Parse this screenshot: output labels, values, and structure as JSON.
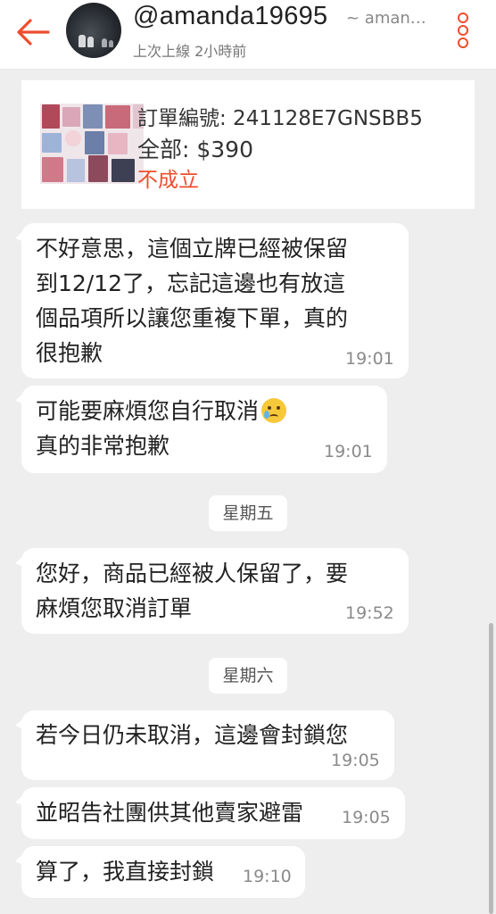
{
  "header": {
    "username": "@amanda19695",
    "shop_name": "~ aman…",
    "last_seen": "上次上線 2小時前"
  },
  "order": {
    "order_number": "訂單編號: 241128E7GNSBB5",
    "total": "全部: $390",
    "status": "不成立"
  },
  "messages": [
    {
      "lines": [
        "不好意思，這個立牌已經被保留",
        "到12/12了，忘記這邊也有放這",
        "個品項所以讓您重複下單，真的",
        "很抱歉"
      ],
      "time": "19:01"
    },
    {
      "lines": [
        "可能要麻煩您自行取消",
        "真的非常抱歉"
      ],
      "time": "19:01",
      "emoji": "tearful-smile-emoji"
    },
    {
      "lines": [
        "您好，商品已經被人保留了，要",
        "麻煩您取消訂單"
      ],
      "time": "19:52"
    },
    {
      "lines": [
        "若今日仍未取消，這邊會封鎖您"
      ],
      "time": "19:05"
    },
    {
      "lines": [
        "並昭告社團供其他賣家避雷"
      ],
      "time": "19:05"
    },
    {
      "lines": [
        "算了，我直接封鎖"
      ],
      "time": "19:10"
    }
  ],
  "day_separators": [
    "星期五",
    "星期六"
  ],
  "icons": {
    "back": "back-arrow-icon",
    "more": "more-vertical-icon"
  },
  "colors": {
    "accent": "#ee4d2d",
    "background": "#eeeeee",
    "bubble": "#ffffff"
  }
}
